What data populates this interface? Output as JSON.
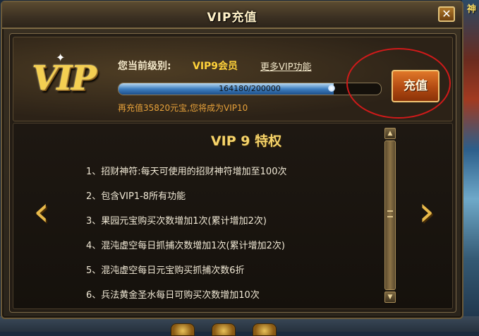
{
  "background": {
    "right_label": "神"
  },
  "window": {
    "title": "VIP充值",
    "close_glyph": "✕"
  },
  "header": {
    "logo_text": "VIP",
    "level_label": "您当前级别:",
    "level_value": "VIP9会员",
    "more_link": "更多VIP功能",
    "progress": {
      "current": 164180,
      "max": 200000,
      "text": "164180/200000"
    },
    "hint": "再充值35820元宝,您将成为VIP10",
    "recharge_label": "充值"
  },
  "benefits": {
    "title": "VIP 9 特权",
    "items": [
      "1、招财神符:每天可使用的招财神符增加至100次",
      "2、包含VIP1-8所有功能",
      "3、果园元宝购买次数增加1次(累计增加2次)",
      "4、混沌虚空每日抓捕次数增加1次(累计增加2次)",
      "5、混沌虚空每日元宝购买抓捕次数6折",
      "6、兵法黄金圣水每日可购买次数增加10次"
    ]
  },
  "icons": {
    "prev": "chevron-left-icon",
    "next": "chevron-right-icon",
    "scroll_up": "triangle-up-icon",
    "scroll_down": "triangle-down-icon"
  },
  "colors": {
    "accent_gold": "#f6d36a",
    "level_yellow": "#ffd23a",
    "hint_orange": "#e8a23a",
    "button_orange": "#b24a12",
    "annotation_red": "#d01a1a"
  }
}
